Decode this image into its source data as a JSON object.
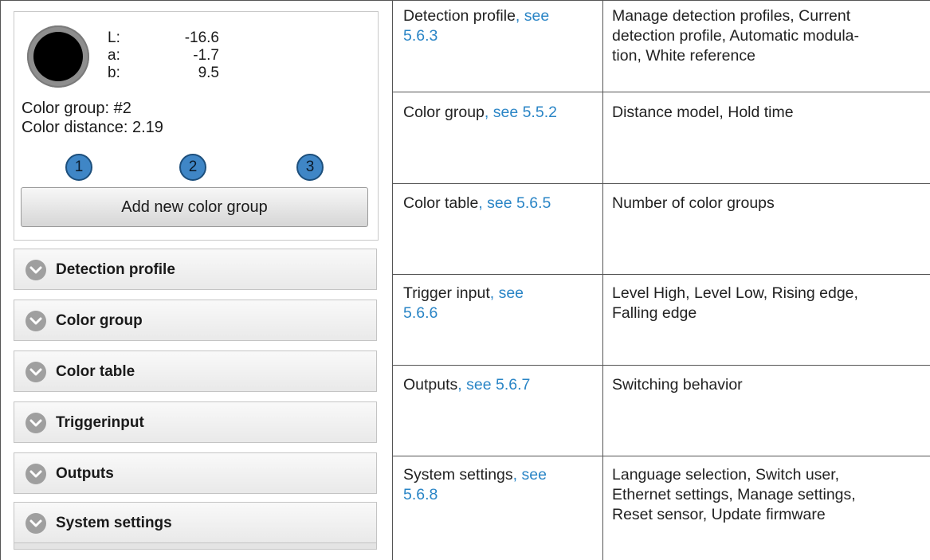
{
  "color_display": {
    "swatch_color": "#000000",
    "values": [
      {
        "key": "L:",
        "value": "-16.6"
      },
      {
        "key": "a:",
        "value": "-1.7"
      },
      {
        "key": "b:",
        "value": "9.5"
      }
    ],
    "color_group": "Color group: #2",
    "color_distance": "Color distance: 2.19",
    "group_buttons": [
      "1",
      "2",
      "3"
    ],
    "add_button": "Add new color group"
  },
  "accordion": [
    {
      "label": "Detection profile",
      "icon": "chevron-down-icon"
    },
    {
      "label": "Color group",
      "icon": "chevron-down-icon"
    },
    {
      "label": "Color table",
      "icon": "chevron-down-icon"
    },
    {
      "label": "Triggerinput",
      "icon": "chevron-down-icon"
    },
    {
      "label": "Outputs",
      "icon": "chevron-down-icon"
    },
    {
      "label": "System settings",
      "icon": "chevron-down-icon"
    }
  ],
  "table": {
    "link_color": "#2a85c6",
    "rows": [
      {
        "menu": "Detection profile",
        "link": ", see",
        "link2": "5.6.3",
        "options1": "Manage detection profiles, Current",
        "options2": "detection profile, Automatic modula-",
        "options3": "tion, White reference"
      },
      {
        "menu": "Color group",
        "link": ", see 5.5.2",
        "options1": "Distance model, Hold time"
      },
      {
        "menu": "Color table",
        "link": ", see 5.6.5",
        "options1": "Number of color groups"
      },
      {
        "menu": "Trigger input",
        "link": ", see",
        "link2": "5.6.6",
        "options1": "Level High, Level Low, Rising edge,",
        "options2": "Falling edge"
      },
      {
        "menu": "Outputs",
        "link": ", see 5.6.7",
        "options1": "Switching behavior"
      },
      {
        "menu": "System settings",
        "link": ", see",
        "link2": "5.6.8",
        "options1": "Language selection, Switch user,",
        "options2": "Ethernet settings, Manage settings,",
        "options3": "Reset sensor, Update firmware"
      }
    ]
  }
}
